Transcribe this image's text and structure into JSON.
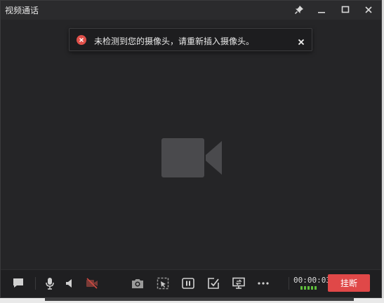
{
  "window": {
    "title": "视频通话",
    "controls": [
      "pin-icon",
      "minimize-icon",
      "maximize-icon",
      "close-icon"
    ]
  },
  "toast": {
    "icon": "error-icon",
    "message": "未检测到您的摄像头，请重新插入摄像头。",
    "close_icon": "close-icon"
  },
  "video": {
    "placeholder_icon": "video-camera-icon"
  },
  "toolbar": {
    "icons": [
      "chat-icon",
      "microphone-icon",
      "speaker-icon",
      "camera-off-icon",
      "snapshot-icon",
      "screen-select-icon",
      "pause-icon",
      "whiteboard-icon",
      "screen-share-icon",
      "more-icon"
    ],
    "timer": "00:00:03",
    "signal_bars": 5,
    "hangup_label": "挂断"
  },
  "colors": {
    "accent_red": "#e04848",
    "signal_green": "#5fbf3c",
    "background": "#252527"
  }
}
